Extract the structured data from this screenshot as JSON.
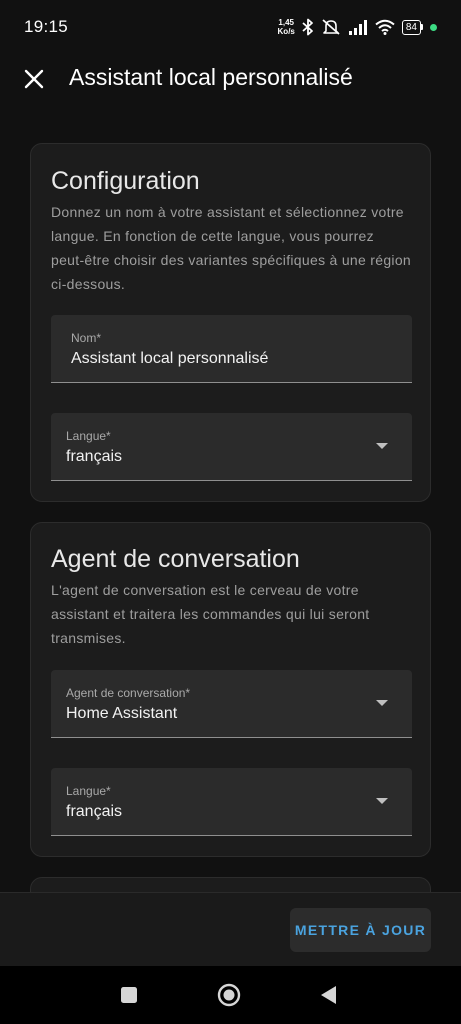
{
  "status_bar": {
    "time": "19:15",
    "net_speed_value": "1,45",
    "net_speed_unit": "Ko/s",
    "battery": "84",
    "icons": [
      "bluetooth-icon",
      "mute-icon",
      "signal-icon",
      "wifi-icon",
      "battery-icon"
    ]
  },
  "app_bar": {
    "title": "Assistant local personnalisé",
    "close_icon": "close-icon"
  },
  "configuration": {
    "title": "Configuration",
    "description": "Donnez un nom à votre assistant et sélectionnez votre langue. En fonction de cette langue, vous pourrez peut-être choisir des variantes spécifiques à une région ci-dessous.",
    "name_field": {
      "label": "Nom*",
      "value": "Assistant local personnalisé"
    },
    "language_field": {
      "label": "Langue*",
      "value": "français"
    }
  },
  "conversation_agent": {
    "title": "Agent de conversation",
    "description": "L'agent de conversation est le cerveau de votre assistant et traitera les commandes qui lui seront transmises.",
    "agent_field": {
      "label": "Agent de conversation*",
      "value": "Home Assistant"
    },
    "language_field": {
      "label": "Langue*",
      "value": "français"
    }
  },
  "footer": {
    "update_button": "METTRE À JOUR"
  },
  "nav_bar": {
    "icons": [
      "recents-icon",
      "home-icon",
      "back-icon"
    ]
  },
  "colors": {
    "background": "#111111",
    "card": "#1c1c1c",
    "field": "#2b2b2b",
    "accent": "#4aa3df"
  }
}
